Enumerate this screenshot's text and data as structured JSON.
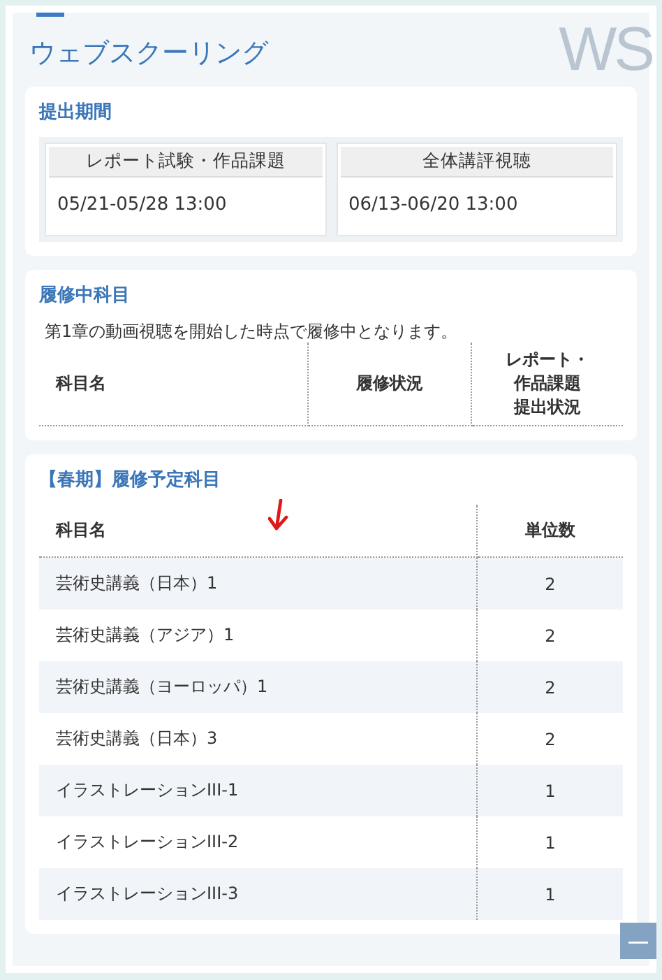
{
  "page": {
    "title": "ウェブスクーリング",
    "logo_text": "WS"
  },
  "submission_period": {
    "heading": "提出期間",
    "periods": [
      {
        "label": "レポート試験・作品課題",
        "value": "05/21-05/28 13:00"
      },
      {
        "label": "全体講評視聴",
        "value": "06/13-06/20 13:00"
      }
    ]
  },
  "current_courses": {
    "heading": "履修中科目",
    "note": "第1章の動画視聴を開始した時点で履修中となります。",
    "columns": [
      {
        "lines": [
          "科目名"
        ]
      },
      {
        "lines": [
          "履修状況"
        ]
      },
      {
        "lines": [
          "レポート・",
          "作品課題",
          "提出状況"
        ]
      }
    ]
  },
  "planned_courses": {
    "heading": "【春期】履修予定科目",
    "columns": [
      "科目名",
      "単位数"
    ],
    "rows": [
      {
        "name": "芸術史講義（日本）1",
        "credits": "2"
      },
      {
        "name": "芸術史講義（アジア）1",
        "credits": "2"
      },
      {
        "name": "芸術史講義（ヨーロッパ）1",
        "credits": "2"
      },
      {
        "name": "芸術史講義（日本）3",
        "credits": "2"
      },
      {
        "name": "イラストレーションIII-1",
        "credits": "1"
      },
      {
        "name": "イラストレーションIII-2",
        "credits": "1"
      },
      {
        "name": "イラストレーションIII-3",
        "credits": "1"
      }
    ]
  },
  "collapse_button": {
    "label": "—"
  }
}
